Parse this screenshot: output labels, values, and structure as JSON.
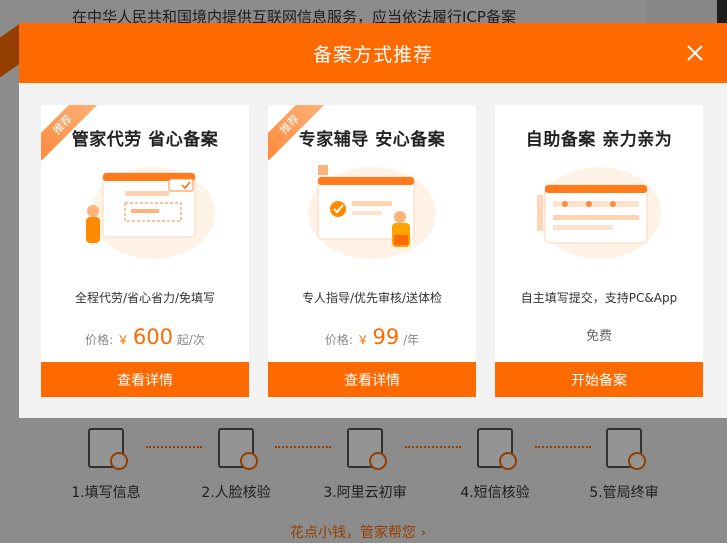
{
  "background": {
    "top_text": "在中华人民共和国境内提供互联网信息服务，应当依法履行ICP备案",
    "steps": [
      {
        "label": "1.填写信息",
        "icon": "form-edit-icon"
      },
      {
        "label": "2.人脸核验",
        "icon": "face-verify-icon"
      },
      {
        "label": "3.阿里云初审",
        "icon": "document-search-icon"
      },
      {
        "label": "4.短信核验",
        "icon": "sms-verify-icon"
      },
      {
        "label": "5.管局终审",
        "icon": "approval-icon"
      }
    ],
    "cta": "花点小钱，管家帮您 ›"
  },
  "modal": {
    "title": "备案方式推荐",
    "close_icon": "close-icon",
    "accent_color": "#ff6a00",
    "cards": [
      {
        "ribbon": "推荐",
        "title": "管家代劳 省心备案",
        "desc": "全程代劳/省心省力/免填写",
        "price_label": "价格:",
        "currency": "￥",
        "price": "600",
        "unit": "起/次",
        "button": "查看详情"
      },
      {
        "ribbon": "推荐",
        "title": "专家辅导 安心备案",
        "desc": "专人指导/优先审核/送体检",
        "price_label": "价格:",
        "currency": "￥",
        "price": "99",
        "unit": "/年",
        "button": "查看详情"
      },
      {
        "title": "自助备案 亲力亲为",
        "desc": "自主填写提交，支持PC&App",
        "price_text": "免费",
        "button": "开始备案"
      }
    ]
  }
}
